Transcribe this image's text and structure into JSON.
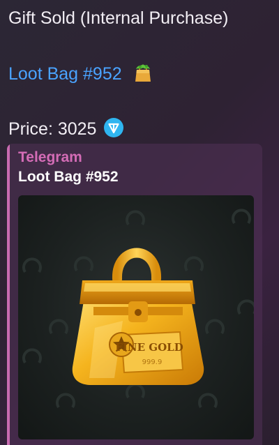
{
  "message": {
    "title": "Gift Sold (Internal Purchase)",
    "gift_link": "Loot Bag #952",
    "price_label": "Price: 3025",
    "price_currency_icon": "ton-coin-icon",
    "link_icon": "shopping-bag-emoji"
  },
  "embed": {
    "site_name": "Telegram",
    "title": "Loot Bag #952",
    "preview_icon": "golden-bag-image",
    "bag_tag_text": "FINE GOLD",
    "bag_tag_number": "999.9"
  },
  "colors": {
    "link": "#4aa3ff",
    "site_name": "#d46cb6",
    "accent_bar": "#c86bb0",
    "ton": "#2fb5f0"
  }
}
